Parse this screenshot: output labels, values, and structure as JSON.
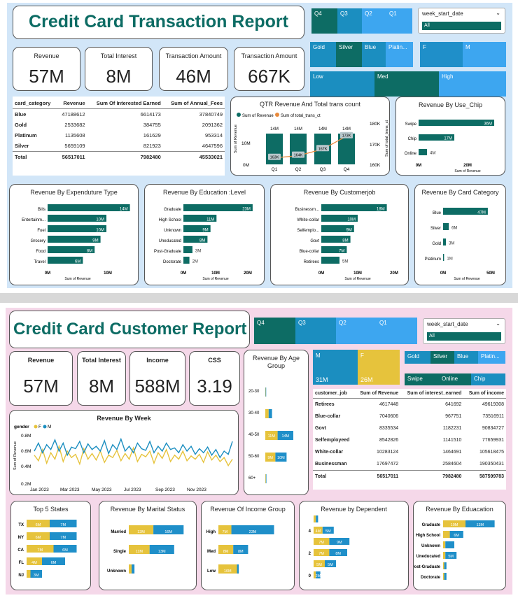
{
  "colors": {
    "teal": "#0d6c64",
    "blue": "#1f8fc9",
    "lightblue": "#3da6f0",
    "yellow": "#e6c33c"
  },
  "report1": {
    "title": "Credit Card Transaction Report",
    "quarters": [
      "Q4",
      "Q3",
      "Q2",
      "Q1"
    ],
    "week_slicer": {
      "label": "week_start_date",
      "value": "All"
    },
    "card_types": [
      "Gold",
      "Silver",
      "Blue",
      "Platin..."
    ],
    "gender": [
      "F",
      "M"
    ],
    "levels": [
      "Low",
      "Med",
      "High"
    ],
    "kpis": [
      {
        "label": "Revenue",
        "value": "57M"
      },
      {
        "label": "Total Interest",
        "value": "8M"
      },
      {
        "label": "Transaction Amount",
        "value": "46M"
      },
      {
        "label": "Transaction Amount",
        "value": "667K"
      }
    ],
    "table": {
      "headers": [
        "card_category",
        "Revenue",
        "Sum Of Interested Earned",
        "Sum of Annual_Fees"
      ],
      "rows": [
        [
          "Blue",
          "47188612",
          "6614173",
          "37840749"
        ],
        [
          "Gold",
          "2533682",
          "384755",
          "2091362"
        ],
        [
          "Platinum",
          "1135608",
          "161629",
          "953314"
        ],
        [
          "Silver",
          "5659109",
          "821923",
          "4647596"
        ]
      ],
      "total": [
        "Total",
        "56517011",
        "7982480",
        "45533021"
      ]
    },
    "qtr": {
      "title": "QTR Revenue And Total trans count",
      "legend": [
        "Sum of Revenue",
        "Sum of total_trans_ct"
      ],
      "ylabel_left": "Sum of Revenue",
      "ylabel_right": "Sum of total_trans_ct",
      "left_ticks": [
        "10M",
        "0M"
      ],
      "right_ticks": [
        "180K",
        "170K",
        "160K"
      ],
      "top_labels": [
        "14M",
        "14M",
        "14M",
        "14M"
      ],
      "line_labels": [
        "163K",
        "164K",
        "167K",
        "173K"
      ]
    },
    "use_chip": {
      "title": "Revenue By Use_Chip",
      "axis": [
        "0M",
        "20M",
        "40M"
      ],
      "xlabel": "Sum of Revenue"
    },
    "exp": {
      "title": "Revenue By Expenduture Type",
      "axis": [
        "0M",
        "10M"
      ],
      "xlabel": "Sum of Revenue"
    },
    "edu": {
      "title": "Revenue By Education :Level",
      "axis": [
        "0M",
        "10M",
        "20M"
      ],
      "xlabel": "Sum of Revenue"
    },
    "job": {
      "title": "Revenue By Customerjob",
      "axis": [
        "0M",
        "10M",
        "20M"
      ],
      "xlabel": "Sum of Revenue"
    },
    "cat": {
      "title": "Revenue By Card Category",
      "axis": [
        "0M",
        "50M"
      ],
      "xlabel": "Sum of Revenue"
    }
  },
  "report2": {
    "title": "Credit Card Customer Report",
    "quarters": [
      "Q4",
      "Q3",
      "Q2",
      "Q1"
    ],
    "week_slicer": {
      "label": "week_start_date",
      "value": "All"
    },
    "kpis": [
      {
        "label": "Revenue",
        "value": "57M"
      },
      {
        "label": "Total Interest",
        "value": "8M"
      },
      {
        "label": "Income",
        "value": "588M"
      },
      {
        "label": "CSS",
        "value": "3.19"
      }
    ],
    "gender_tree": [
      {
        "label": "M",
        "value": "31M"
      },
      {
        "label": "F",
        "value": "26M"
      }
    ],
    "card_types": [
      "Gold",
      "Silver",
      "Blue",
      "Platin..."
    ],
    "chip_types": [
      "Swipe",
      "Online",
      "Chip"
    ],
    "table": {
      "headers": [
        "customer_job",
        "Sum of Revenue",
        "Sum of interest_earned",
        "Sum of income"
      ],
      "rows": [
        [
          "Retirees",
          "4617448",
          "641692",
          "49619308"
        ],
        [
          "Blue-collar",
          "7040606",
          "967751",
          "73516911"
        ],
        [
          "Govt",
          "8335534",
          "1182231",
          "90834727"
        ],
        [
          "Selfemployeed",
          "8542826",
          "1141510",
          "77659931"
        ],
        [
          "White-collar",
          "10283124",
          "1464691",
          "105618475"
        ],
        [
          "Businessman",
          "17697472",
          "2584604",
          "190350431"
        ]
      ],
      "total": [
        "Total",
        "56517011",
        "7982480",
        "587599783"
      ]
    },
    "age": {
      "title": "Revenue By Age Group"
    },
    "week": {
      "title": "Revenue By Week",
      "legend_title": "gender",
      "legend": [
        "F",
        "M"
      ],
      "yticks": [
        "0.8M",
        "0.6M",
        "0.4M",
        "0.2M"
      ],
      "xticks": [
        "Jan 2023",
        "Mar 2023",
        "May 2023",
        "Jul 2023",
        "Sep 2023",
        "Nov 2023"
      ],
      "ylabel": "Sum of Revenue"
    },
    "states": {
      "title": "Top 5 States"
    },
    "marital": {
      "title": "Revenue By Marital Status"
    },
    "income": {
      "title": "Revenue Of Income Group"
    },
    "dependent": {
      "title": "Revenue by Dependent"
    },
    "educ": {
      "title": "Revenue By Eduacation"
    }
  },
  "chart_data": [
    {
      "type": "bar",
      "title": "QTR Revenue And Total trans count",
      "categories": [
        "Q1",
        "Q2",
        "Q3",
        "Q4"
      ],
      "series": [
        {
          "name": "Sum of Revenue",
          "values": [
            14,
            14,
            14,
            14
          ]
        },
        {
          "name": "Sum of total_trans_ct",
          "values": [
            163,
            164,
            167,
            173
          ]
        }
      ]
    },
    {
      "type": "bar",
      "title": "Revenue By Use_Chip",
      "categories": [
        "Swipe",
        "Chip",
        "Online"
      ],
      "values": [
        36,
        17,
        4
      ]
    },
    {
      "type": "bar",
      "title": "Revenue By Expenduture Type",
      "categories": [
        "Bills",
        "Entertainm...",
        "Fuel",
        "Grocery",
        "Food",
        "Travel"
      ],
      "values": [
        14,
        10,
        10,
        9,
        8,
        6
      ],
      "labels": [
        "14M",
        "10M",
        "10M",
        "9M",
        "8M",
        "6M"
      ]
    },
    {
      "type": "bar",
      "title": "Revenue By Education :Level",
      "categories": [
        "Graduate",
        "High School",
        "Unknown",
        "Uneducated",
        "Post-Graduate",
        "Doctorate"
      ],
      "values": [
        23,
        11,
        9,
        8,
        3,
        2
      ]
    },
    {
      "type": "bar",
      "title": "Revenue By Customerjob",
      "categories": [
        "Businessm...",
        "White-collar",
        "Selfemplo...",
        "Govt",
        "Blue-collar",
        "Retirees"
      ],
      "values": [
        18,
        10,
        9,
        8,
        7,
        5
      ]
    },
    {
      "type": "bar",
      "title": "Revenue By Card Category",
      "categories": [
        "Blue",
        "Silver",
        "Gold",
        "Platinum"
      ],
      "values": [
        47,
        6,
        3,
        1
      ]
    },
    {
      "type": "bar",
      "title": "Revenue By Age Group",
      "categories": [
        "20-30",
        "30-40",
        "40-50",
        "50-60",
        "60+"
      ],
      "series": [
        {
          "name": "F",
          "values": [
            0.3,
            3,
            11,
            9,
            0.5
          ]
        },
        {
          "name": "M",
          "values": [
            0.5,
            3,
            14,
            10,
            0.5
          ]
        }
      ],
      "labels": {
        "40-50": [
          "11M",
          "14M"
        ],
        "50-60": [
          "9M",
          "10M"
        ]
      }
    },
    {
      "type": "bar",
      "title": "Top 5 States",
      "categories": [
        "TX",
        "NY",
        "CA",
        "FL",
        "NJ"
      ],
      "series": [
        {
          "name": "F",
          "values": [
            6,
            6,
            7,
            4,
            1
          ]
        },
        {
          "name": "M",
          "values": [
            7,
            7,
            6,
            6,
            3
          ]
        }
      ]
    },
    {
      "type": "bar",
      "title": "Revenue By Marital Status",
      "categories": [
        "Married",
        "Single",
        "Unknown"
      ],
      "series": [
        {
          "name": "F",
          "values": [
            13,
            11,
            1.5
          ]
        },
        {
          "name": "M",
          "values": [
            16,
            13,
            1.5
          ]
        }
      ]
    },
    {
      "type": "bar",
      "title": "Revenue Of Income Group",
      "categories": [
        "High",
        "Med",
        "Low"
      ],
      "series": [
        {
          "name": "F",
          "values": [
            7,
            8,
            10
          ]
        },
        {
          "name": "M",
          "values": [
            23,
            8,
            1
          ]
        }
      ]
    },
    {
      "type": "bar",
      "title": "Revenue by Dependent",
      "categories": [
        "4",
        "",
        "2",
        "",
        "0"
      ],
      "series": [
        {
          "name": "F",
          "values": [
            1,
            4,
            7,
            7,
            5,
            1
          ]
        },
        {
          "name": "M",
          "values": [
            1,
            5,
            9,
            8,
            5,
            2
          ]
        }
      ],
      "labels": [
        [
          "",
          ""
        ],
        [
          "4M",
          "5M"
        ],
        [
          "7M",
          "9M"
        ],
        [
          "7M",
          "8M"
        ],
        [
          "5M",
          "5M"
        ],
        [
          "",
          "2M"
        ]
      ]
    },
    {
      "type": "bar",
      "title": "Revenue By Eduacation",
      "categories": [
        "Graduate",
        "High School",
        "Unknown",
        "Uneducated",
        "Post-Graduate",
        "Doctorate"
      ],
      "series": [
        {
          "name": "F",
          "values": [
            10,
            3,
            1,
            1,
            0.5,
            0.5
          ]
        },
        {
          "name": "M",
          "values": [
            13,
            6,
            4,
            5,
            1,
            1
          ]
        }
      ]
    }
  ]
}
